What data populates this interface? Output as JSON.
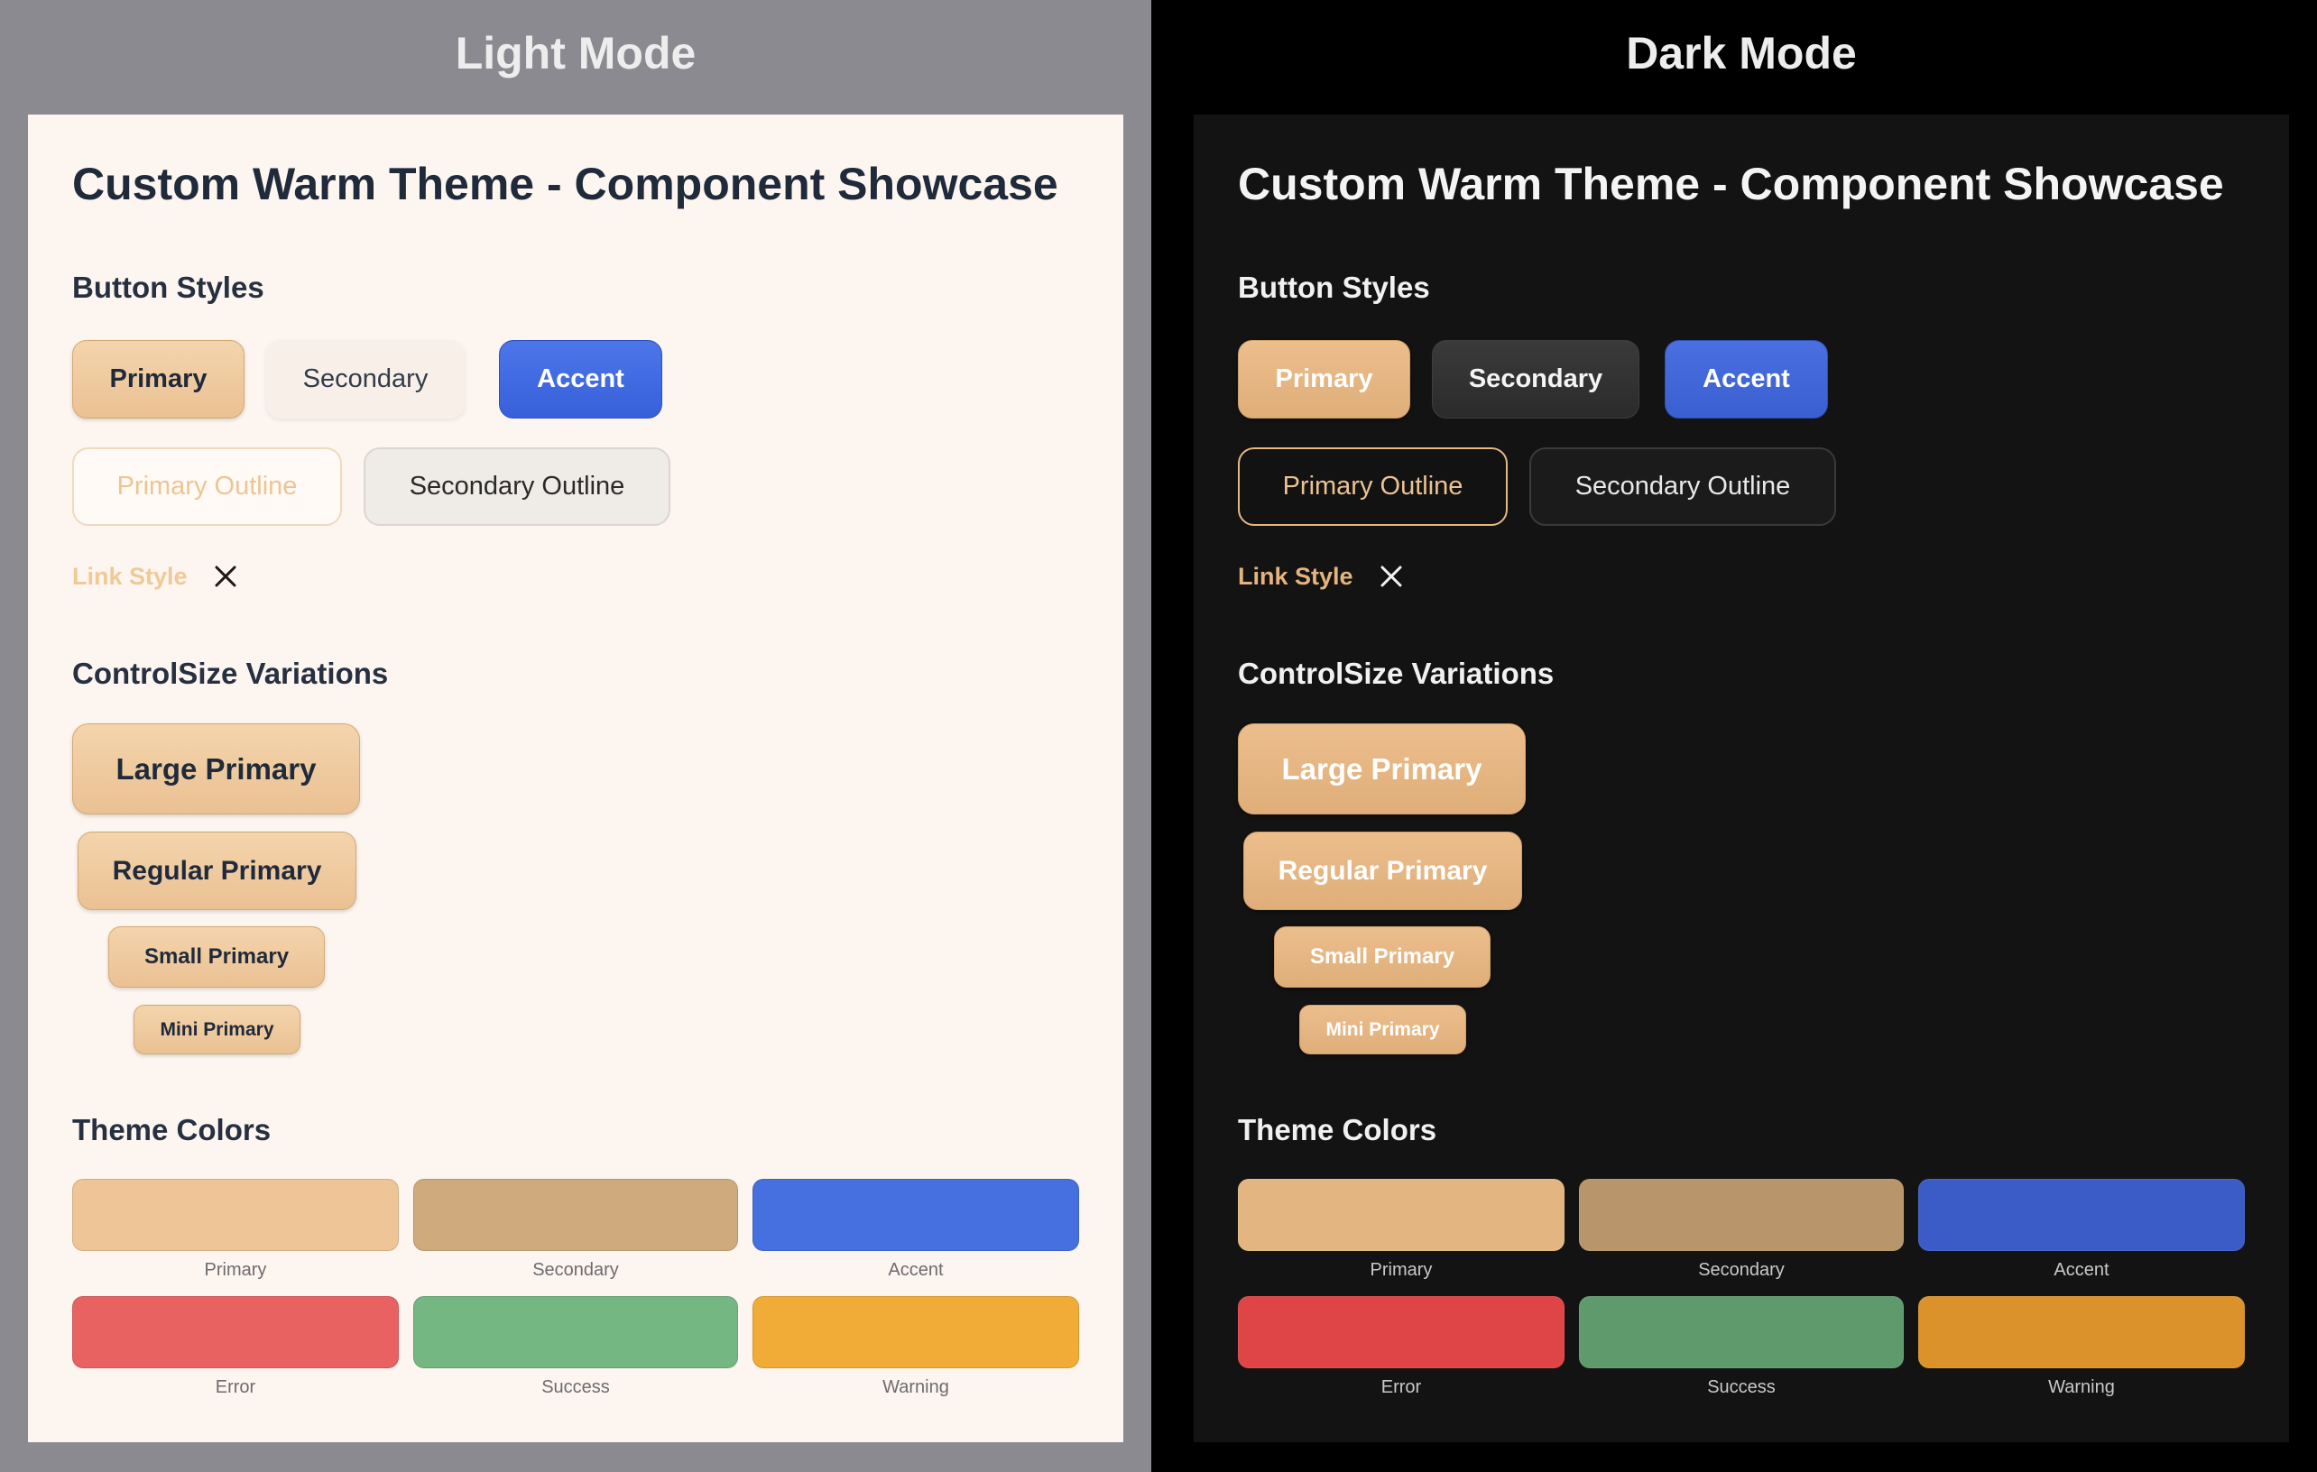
{
  "panels": [
    {
      "mode_title": "Light Mode",
      "title": "Custom Warm Theme - Component Showcase",
      "button_styles_heading": "Button Styles",
      "buttons": {
        "primary": "Primary",
        "secondary": "Secondary",
        "accent": "Accent",
        "primary_outline": "Primary Outline",
        "secondary_outline": "Secondary Outline",
        "link": "Link Style"
      },
      "controlsize_heading": "ControlSize Variations",
      "sizes": {
        "large": "Large Primary",
        "regular": "Regular Primary",
        "small": "Small Primary",
        "mini": "Mini Primary"
      },
      "theme_colors_heading": "Theme Colors",
      "colors": [
        {
          "label": "Primary",
          "hex": "#eec596"
        },
        {
          "label": "Secondary",
          "hex": "#cfaa7d"
        },
        {
          "label": "Accent",
          "hex": "#4670e0"
        },
        {
          "label": "Error",
          "hex": "#e86262"
        },
        {
          "label": "Success",
          "hex": "#74b783"
        },
        {
          "label": "Warning",
          "hex": "#f1ac38"
        }
      ],
      "close_icon": "close-icon"
    },
    {
      "mode_title": "Dark Mode",
      "title": "Custom Warm Theme - Component Showcase",
      "button_styles_heading": "Button Styles",
      "buttons": {
        "primary": "Primary",
        "secondary": "Secondary",
        "accent": "Accent",
        "primary_outline": "Primary Outline",
        "secondary_outline": "Secondary Outline",
        "link": "Link Style"
      },
      "controlsize_heading": "ControlSize Variations",
      "sizes": {
        "large": "Large Primary",
        "regular": "Regular Primary",
        "small": "Small Primary",
        "mini": "Mini Primary"
      },
      "theme_colors_heading": "Theme Colors",
      "colors": [
        {
          "label": "Primary",
          "hex": "#e3b681"
        },
        {
          "label": "Secondary",
          "hex": "#b8956a"
        },
        {
          "label": "Accent",
          "hex": "#3b5cc6"
        },
        {
          "label": "Error",
          "hex": "#df4446"
        },
        {
          "label": "Success",
          "hex": "#5f9a6d"
        },
        {
          "label": "Warning",
          "hex": "#db922b"
        }
      ],
      "close_icon": "close-icon"
    }
  ]
}
